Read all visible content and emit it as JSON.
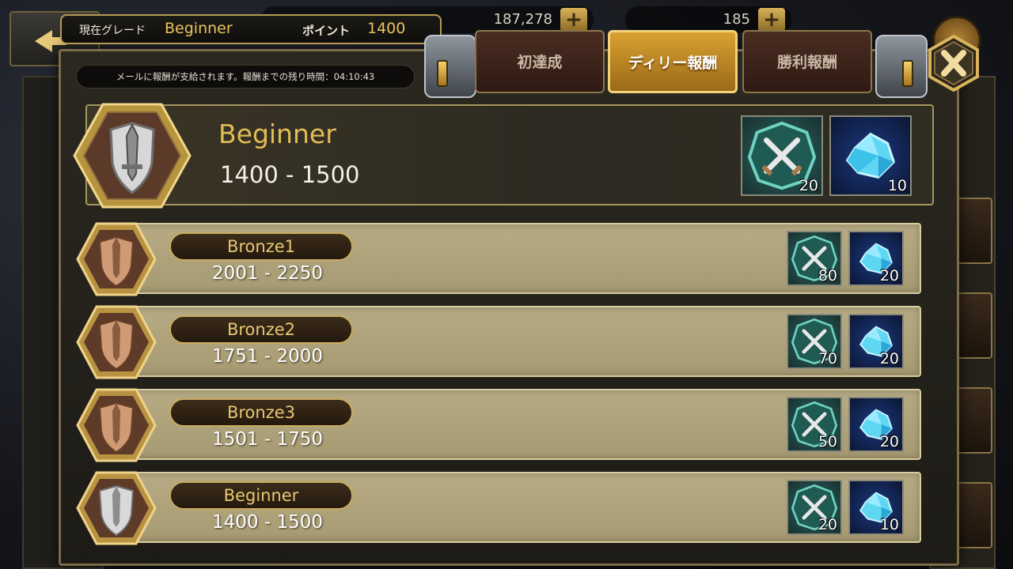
{
  "hud": {
    "gold_value": "187,278",
    "gem_value": "185"
  },
  "grade_bar": {
    "grade_label": "現在グレード",
    "grade_value": "Beginner",
    "point_label": "ポイント",
    "point_value": "1400"
  },
  "mail_notice": "メールに報酬が支給されます。報酬までの残り時間：04:10:43",
  "tabs": [
    {
      "label": "初達成",
      "active": false
    },
    {
      "label": "ディリー報酬",
      "active": true
    },
    {
      "label": "勝利報酬",
      "active": false
    }
  ],
  "current": {
    "name": "Beginner",
    "range": "1400 - 1500",
    "rewards": [
      {
        "type": "sword-ticket",
        "qty": "20"
      },
      {
        "type": "crystal",
        "qty": "10"
      }
    ]
  },
  "rows": [
    {
      "name": "Bronze1",
      "range": "2001 - 2250",
      "rewards": [
        {
          "type": "sword-ticket",
          "qty": "80"
        },
        {
          "type": "crystal",
          "qty": "20"
        }
      ]
    },
    {
      "name": "Bronze2",
      "range": "1751 - 2000",
      "rewards": [
        {
          "type": "sword-ticket",
          "qty": "70"
        },
        {
          "type": "crystal",
          "qty": "20"
        }
      ]
    },
    {
      "name": "Bronze3",
      "range": "1501 - 1750",
      "rewards": [
        {
          "type": "sword-ticket",
          "qty": "50"
        },
        {
          "type": "crystal",
          "qty": "20"
        }
      ]
    },
    {
      "name": "Beginner",
      "range": "1400 - 1500",
      "rewards": [
        {
          "type": "sword-ticket",
          "qty": "20"
        },
        {
          "type": "crystal",
          "qty": "10"
        }
      ]
    }
  ],
  "colors": {
    "accent_gold": "#e2bd55",
    "active_tab": "#d9a132",
    "row_bg": "#b7ab85"
  }
}
